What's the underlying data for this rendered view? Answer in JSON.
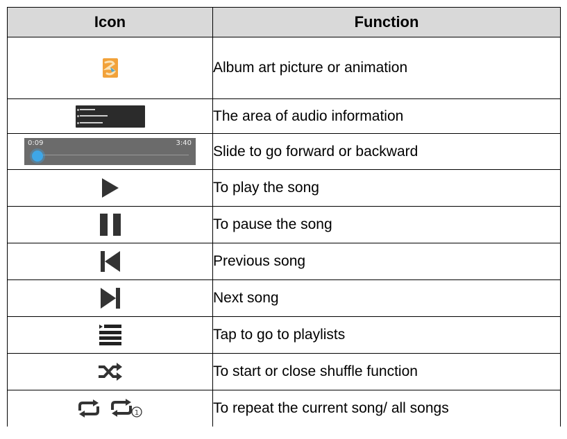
{
  "table": {
    "headers": {
      "icon": "Icon",
      "function": "Function"
    },
    "rows": [
      {
        "icon": "album-art-icon",
        "function": "Album art picture or animation"
      },
      {
        "icon": "audio-info-area-icon",
        "function": "The area of audio information"
      },
      {
        "icon": "seek-bar-icon",
        "function": "Slide to go forward or backward",
        "seek": {
          "elapsed": "0:09",
          "total": "3:40"
        }
      },
      {
        "icon": "play-icon",
        "function": "To play the song"
      },
      {
        "icon": "pause-icon",
        "function": "To pause the song"
      },
      {
        "icon": "previous-icon",
        "function": "Previous song"
      },
      {
        "icon": "next-icon",
        "function": "Next song"
      },
      {
        "icon": "playlist-icon",
        "function": "Tap to go to playlists"
      },
      {
        "icon": "shuffle-icon",
        "function": "To start or close shuffle function"
      },
      {
        "icon": "repeat-icon",
        "function": "To repeat the current song/ all songs",
        "repeat_one_badge": "1"
      }
    ]
  },
  "colors": {
    "header_bg": "#d9d9d9",
    "icon_dark": "#333333",
    "seek_knob": "#3ea7e8",
    "album_art": "#f2a23a"
  }
}
